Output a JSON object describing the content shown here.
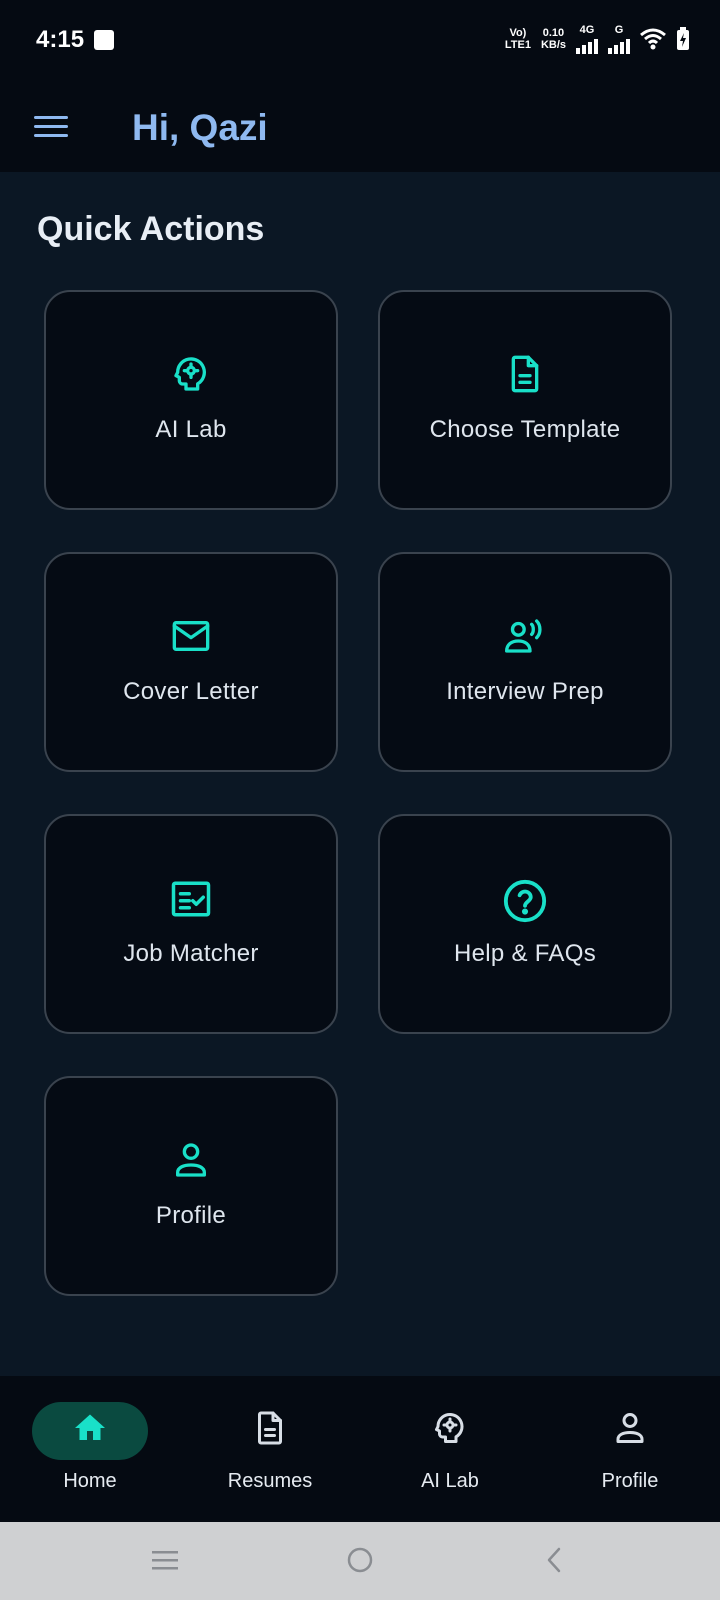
{
  "status_bar": {
    "time": "4:15",
    "volte_top": "Vo)",
    "volte_bottom": "LTE1",
    "speed_top": "0.10",
    "speed_bottom": "KB/s",
    "network_1": "4G",
    "network_2": "G"
  },
  "header": {
    "greeting": "Hi, Qazi"
  },
  "main": {
    "section_title": "Quick Actions",
    "actions": [
      {
        "label": "AI Lab",
        "icon": "brain-gear-icon"
      },
      {
        "label": "Choose Template",
        "icon": "document-icon"
      },
      {
        "label": "Cover Letter",
        "icon": "envelope-icon"
      },
      {
        "label": "Interview Prep",
        "icon": "person-speaking-icon"
      },
      {
        "label": "Job Matcher",
        "icon": "checklist-icon"
      },
      {
        "label": "Help & FAQs",
        "icon": "help-circle-icon"
      },
      {
        "label": "Profile",
        "icon": "person-icon"
      }
    ]
  },
  "bottom_nav": {
    "items": [
      {
        "label": "Home",
        "icon": "home-icon",
        "active": true
      },
      {
        "label": "Resumes",
        "icon": "document-icon"
      },
      {
        "label": "AI Lab",
        "icon": "brain-gear-icon"
      },
      {
        "label": "Profile",
        "icon": "person-icon"
      }
    ]
  },
  "colors": {
    "accent": "#19e0c8",
    "greeting": "#8fb9f0",
    "background": "#0b1724",
    "card": "#050b14",
    "active_pill": "#0a4a40"
  }
}
